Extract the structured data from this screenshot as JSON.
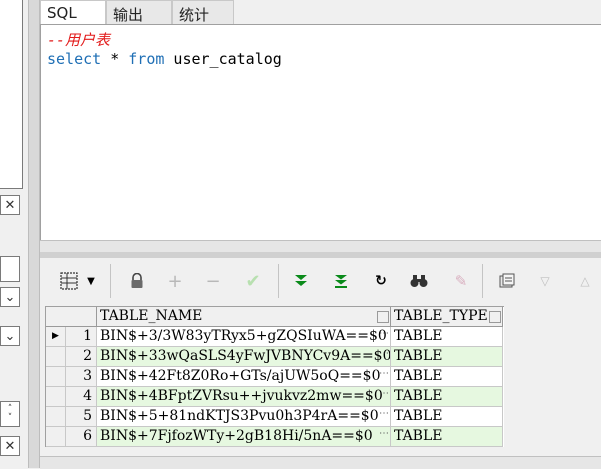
{
  "tabs": [
    {
      "label": "SQL"
    },
    {
      "label": "输出"
    },
    {
      "label": "统计"
    }
  ],
  "editor": {
    "comment": "--用户表",
    "line2": {
      "kw1": "select",
      "mid": " * ",
      "kw2": "from",
      "tail": " user_catalog"
    }
  },
  "toolbar": {
    "grid_menu_icon": "grid-icon",
    "lock_icon": "lock-icon",
    "plus_icon": "plus-icon",
    "minus_icon": "minus-icon",
    "check_icon": "check-icon",
    "fetch_next_icon": "double-down-arrow-icon",
    "fetch_all_icon": "fetch-last-icon",
    "refresh_icon": "refresh-icon",
    "find_icon": "binoculars-icon",
    "clear_icon": "eraser-icon",
    "export_icon": "export-icon",
    "down_icon": "triangle-down-icon",
    "up_icon": "triangle-up-icon"
  },
  "grid": {
    "columns": [
      "TABLE_NAME",
      "TABLE_TYPE"
    ],
    "rows": [
      {
        "num": "1",
        "name": "BIN$+3/3W83yTRyx5+gZQSIuWA==$0",
        "type": "TABLE"
      },
      {
        "num": "2",
        "name": "BIN$+33wQaSLS4yFwJVBNYCv9A==$0",
        "type": "TABLE"
      },
      {
        "num": "3",
        "name": "BIN$+42Ft8Z0Ro+GTs/ajUW5oQ==$0",
        "type": "TABLE"
      },
      {
        "num": "4",
        "name": "BIN$+4BFptZVRsu++jvukvz2mw==$0",
        "type": "TABLE"
      },
      {
        "num": "5",
        "name": "BIN$+5+81ndKTJS3Pvu0h3P4rA==$0",
        "type": "TABLE"
      },
      {
        "num": "6",
        "name": "BIN$+7FjfozWTy+2gB18Hi/5nA==$0",
        "type": "TABLE"
      }
    ]
  },
  "colors": {
    "alt_row": "#e6f8e0",
    "keyword": "#1f6fb5",
    "comment": "#e21a1a",
    "go_green": "#0a8a1a"
  }
}
